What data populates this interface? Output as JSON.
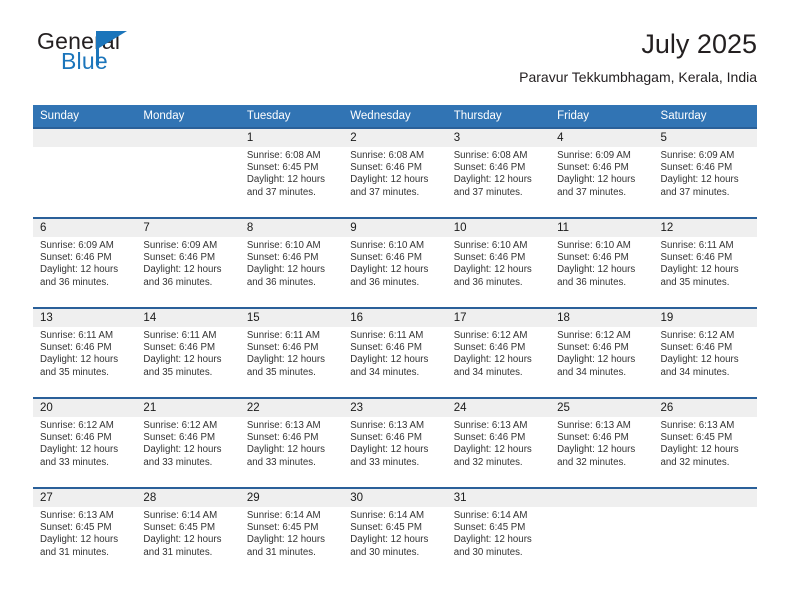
{
  "brand": {
    "name_part1": "General",
    "name_part2": "Blue",
    "accent_color": "#1b75bb"
  },
  "header": {
    "title": "July 2025",
    "subtitle": "Paravur Tekkumbhagam, Kerala, India"
  },
  "theme": {
    "header_blue": "#3174b4",
    "rule_blue": "#2a6099",
    "daynum_band": "#efefef"
  },
  "weekdays": [
    "Sunday",
    "Monday",
    "Tuesday",
    "Wednesday",
    "Thursday",
    "Friday",
    "Saturday"
  ],
  "weeks": [
    [
      {
        "day": "",
        "sunrise": "",
        "sunset": "",
        "daylight_line1": "",
        "daylight_line2": ""
      },
      {
        "day": "",
        "sunrise": "",
        "sunset": "",
        "daylight_line1": "",
        "daylight_line2": ""
      },
      {
        "day": "1",
        "sunrise": "Sunrise: 6:08 AM",
        "sunset": "Sunset: 6:45 PM",
        "daylight_line1": "Daylight: 12 hours",
        "daylight_line2": "and 37 minutes."
      },
      {
        "day": "2",
        "sunrise": "Sunrise: 6:08 AM",
        "sunset": "Sunset: 6:46 PM",
        "daylight_line1": "Daylight: 12 hours",
        "daylight_line2": "and 37 minutes."
      },
      {
        "day": "3",
        "sunrise": "Sunrise: 6:08 AM",
        "sunset": "Sunset: 6:46 PM",
        "daylight_line1": "Daylight: 12 hours",
        "daylight_line2": "and 37 minutes."
      },
      {
        "day": "4",
        "sunrise": "Sunrise: 6:09 AM",
        "sunset": "Sunset: 6:46 PM",
        "daylight_line1": "Daylight: 12 hours",
        "daylight_line2": "and 37 minutes."
      },
      {
        "day": "5",
        "sunrise": "Sunrise: 6:09 AM",
        "sunset": "Sunset: 6:46 PM",
        "daylight_line1": "Daylight: 12 hours",
        "daylight_line2": "and 37 minutes."
      }
    ],
    [
      {
        "day": "6",
        "sunrise": "Sunrise: 6:09 AM",
        "sunset": "Sunset: 6:46 PM",
        "daylight_line1": "Daylight: 12 hours",
        "daylight_line2": "and 36 minutes."
      },
      {
        "day": "7",
        "sunrise": "Sunrise: 6:09 AM",
        "sunset": "Sunset: 6:46 PM",
        "daylight_line1": "Daylight: 12 hours",
        "daylight_line2": "and 36 minutes."
      },
      {
        "day": "8",
        "sunrise": "Sunrise: 6:10 AM",
        "sunset": "Sunset: 6:46 PM",
        "daylight_line1": "Daylight: 12 hours",
        "daylight_line2": "and 36 minutes."
      },
      {
        "day": "9",
        "sunrise": "Sunrise: 6:10 AM",
        "sunset": "Sunset: 6:46 PM",
        "daylight_line1": "Daylight: 12 hours",
        "daylight_line2": "and 36 minutes."
      },
      {
        "day": "10",
        "sunrise": "Sunrise: 6:10 AM",
        "sunset": "Sunset: 6:46 PM",
        "daylight_line1": "Daylight: 12 hours",
        "daylight_line2": "and 36 minutes."
      },
      {
        "day": "11",
        "sunrise": "Sunrise: 6:10 AM",
        "sunset": "Sunset: 6:46 PM",
        "daylight_line1": "Daylight: 12 hours",
        "daylight_line2": "and 36 minutes."
      },
      {
        "day": "12",
        "sunrise": "Sunrise: 6:11 AM",
        "sunset": "Sunset: 6:46 PM",
        "daylight_line1": "Daylight: 12 hours",
        "daylight_line2": "and 35 minutes."
      }
    ],
    [
      {
        "day": "13",
        "sunrise": "Sunrise: 6:11 AM",
        "sunset": "Sunset: 6:46 PM",
        "daylight_line1": "Daylight: 12 hours",
        "daylight_line2": "and 35 minutes."
      },
      {
        "day": "14",
        "sunrise": "Sunrise: 6:11 AM",
        "sunset": "Sunset: 6:46 PM",
        "daylight_line1": "Daylight: 12 hours",
        "daylight_line2": "and 35 minutes."
      },
      {
        "day": "15",
        "sunrise": "Sunrise: 6:11 AM",
        "sunset": "Sunset: 6:46 PM",
        "daylight_line1": "Daylight: 12 hours",
        "daylight_line2": "and 35 minutes."
      },
      {
        "day": "16",
        "sunrise": "Sunrise: 6:11 AM",
        "sunset": "Sunset: 6:46 PM",
        "daylight_line1": "Daylight: 12 hours",
        "daylight_line2": "and 34 minutes."
      },
      {
        "day": "17",
        "sunrise": "Sunrise: 6:12 AM",
        "sunset": "Sunset: 6:46 PM",
        "daylight_line1": "Daylight: 12 hours",
        "daylight_line2": "and 34 minutes."
      },
      {
        "day": "18",
        "sunrise": "Sunrise: 6:12 AM",
        "sunset": "Sunset: 6:46 PM",
        "daylight_line1": "Daylight: 12 hours",
        "daylight_line2": "and 34 minutes."
      },
      {
        "day": "19",
        "sunrise": "Sunrise: 6:12 AM",
        "sunset": "Sunset: 6:46 PM",
        "daylight_line1": "Daylight: 12 hours",
        "daylight_line2": "and 34 minutes."
      }
    ],
    [
      {
        "day": "20",
        "sunrise": "Sunrise: 6:12 AM",
        "sunset": "Sunset: 6:46 PM",
        "daylight_line1": "Daylight: 12 hours",
        "daylight_line2": "and 33 minutes."
      },
      {
        "day": "21",
        "sunrise": "Sunrise: 6:12 AM",
        "sunset": "Sunset: 6:46 PM",
        "daylight_line1": "Daylight: 12 hours",
        "daylight_line2": "and 33 minutes."
      },
      {
        "day": "22",
        "sunrise": "Sunrise: 6:13 AM",
        "sunset": "Sunset: 6:46 PM",
        "daylight_line1": "Daylight: 12 hours",
        "daylight_line2": "and 33 minutes."
      },
      {
        "day": "23",
        "sunrise": "Sunrise: 6:13 AM",
        "sunset": "Sunset: 6:46 PM",
        "daylight_line1": "Daylight: 12 hours",
        "daylight_line2": "and 33 minutes."
      },
      {
        "day": "24",
        "sunrise": "Sunrise: 6:13 AM",
        "sunset": "Sunset: 6:46 PM",
        "daylight_line1": "Daylight: 12 hours",
        "daylight_line2": "and 32 minutes."
      },
      {
        "day": "25",
        "sunrise": "Sunrise: 6:13 AM",
        "sunset": "Sunset: 6:46 PM",
        "daylight_line1": "Daylight: 12 hours",
        "daylight_line2": "and 32 minutes."
      },
      {
        "day": "26",
        "sunrise": "Sunrise: 6:13 AM",
        "sunset": "Sunset: 6:45 PM",
        "daylight_line1": "Daylight: 12 hours",
        "daylight_line2": "and 32 minutes."
      }
    ],
    [
      {
        "day": "27",
        "sunrise": "Sunrise: 6:13 AM",
        "sunset": "Sunset: 6:45 PM",
        "daylight_line1": "Daylight: 12 hours",
        "daylight_line2": "and 31 minutes."
      },
      {
        "day": "28",
        "sunrise": "Sunrise: 6:14 AM",
        "sunset": "Sunset: 6:45 PM",
        "daylight_line1": "Daylight: 12 hours",
        "daylight_line2": "and 31 minutes."
      },
      {
        "day": "29",
        "sunrise": "Sunrise: 6:14 AM",
        "sunset": "Sunset: 6:45 PM",
        "daylight_line1": "Daylight: 12 hours",
        "daylight_line2": "and 31 minutes."
      },
      {
        "day": "30",
        "sunrise": "Sunrise: 6:14 AM",
        "sunset": "Sunset: 6:45 PM",
        "daylight_line1": "Daylight: 12 hours",
        "daylight_line2": "and 30 minutes."
      },
      {
        "day": "31",
        "sunrise": "Sunrise: 6:14 AM",
        "sunset": "Sunset: 6:45 PM",
        "daylight_line1": "Daylight: 12 hours",
        "daylight_line2": "and 30 minutes."
      },
      {
        "day": "",
        "sunrise": "",
        "sunset": "",
        "daylight_line1": "",
        "daylight_line2": ""
      },
      {
        "day": "",
        "sunrise": "",
        "sunset": "",
        "daylight_line1": "",
        "daylight_line2": ""
      }
    ]
  ]
}
